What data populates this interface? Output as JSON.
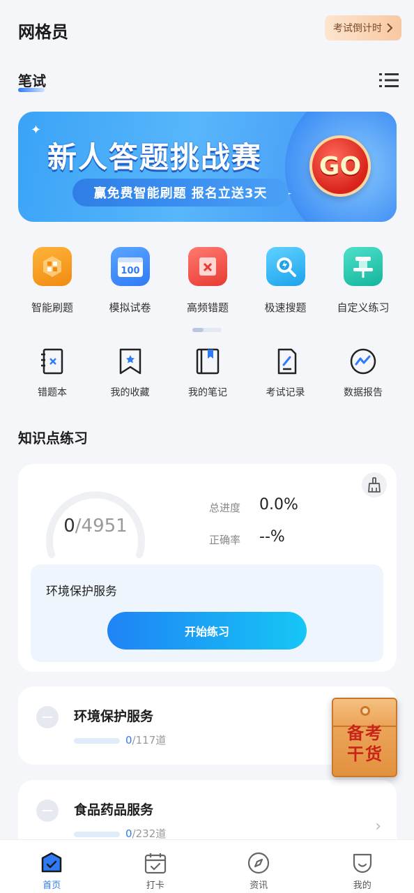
{
  "header": {
    "title": "网格员",
    "countdown_label": "考试倒计时"
  },
  "section_tab": {
    "label": "笔试"
  },
  "banner": {
    "title": "新人答题挑战赛",
    "subtitle": "赢免费智能刷题  报名立送3天",
    "go_label": "GO"
  },
  "quick_actions": [
    {
      "label": "智能刷题",
      "icon": "smart-practice-icon",
      "color": "#f7a01e"
    },
    {
      "label": "模拟试卷",
      "icon": "mock-exam-icon",
      "badge": "100",
      "color": "#3a8ef6"
    },
    {
      "label": "高频错题",
      "icon": "frequent-mistakes-icon",
      "color": "#f04b43"
    },
    {
      "label": "极速搜题",
      "icon": "quick-search-icon",
      "color": "#24b6f0"
    },
    {
      "label": "自定义练习",
      "icon": "custom-practice-icon",
      "color": "#1fc7b0"
    }
  ],
  "tools": [
    {
      "label": "错题本",
      "icon": "mistake-book-icon"
    },
    {
      "label": "我的收藏",
      "icon": "bookmark-icon"
    },
    {
      "label": "我的笔记",
      "icon": "notes-icon"
    },
    {
      "label": "考试记录",
      "icon": "exam-record-icon"
    },
    {
      "label": "数据报告",
      "icon": "data-report-icon"
    }
  ],
  "knowledge": {
    "title": "知识点练习",
    "done": "0",
    "total": "/4951",
    "progress_label": "总进度",
    "progress_value": "0.0%",
    "accuracy_label": "正确率",
    "accuracy_value": "--%",
    "current_topic": "环境保护服务",
    "start_label": "开始练习"
  },
  "categories": [
    {
      "name": "环境保护服务",
      "done": "0",
      "total": "/117道"
    },
    {
      "name": "食品药品服务",
      "done": "0",
      "total": "/232道"
    }
  ],
  "floating_badge": {
    "text": "备考干货"
  },
  "tabbar": [
    {
      "label": "首页",
      "icon": "home-icon",
      "active": true
    },
    {
      "label": "打卡",
      "icon": "calendar-check-icon"
    },
    {
      "label": "资讯",
      "icon": "compass-icon"
    },
    {
      "label": "我的",
      "icon": "profile-icon"
    }
  ]
}
